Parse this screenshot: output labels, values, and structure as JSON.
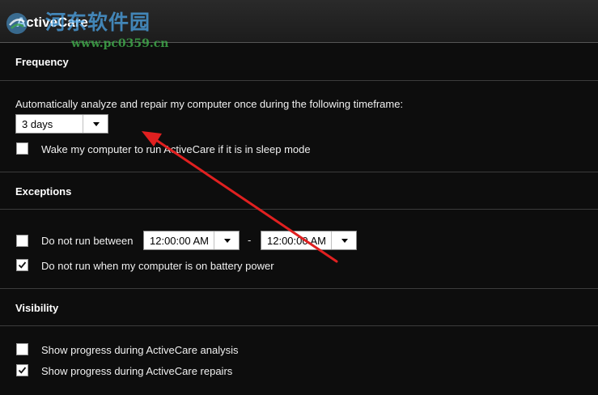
{
  "window": {
    "title": "ActiveCare"
  },
  "watermark": {
    "main": "河东软件园",
    "url": "www.pc0359.cn"
  },
  "frequency": {
    "heading": "Frequency",
    "description": "Automatically analyze and repair my computer once during the following timeframe:",
    "timeframe_value": "3 days",
    "wake_label": "Wake my computer to run ActiveCare if it is in sleep mode",
    "wake_checked": false
  },
  "exceptions": {
    "heading": "Exceptions",
    "between_label": "Do not run between",
    "between_checked": false,
    "start_time": "12:00:00 AM",
    "separator": "-",
    "end_time": "12:00:00 AM",
    "battery_label": "Do not run when my computer is on battery power",
    "battery_checked": true
  },
  "visibility": {
    "heading": "Visibility",
    "analysis_label": "Show progress during ActiveCare analysis",
    "analysis_checked": false,
    "repairs_label": "Show progress during ActiveCare repairs",
    "repairs_checked": true
  },
  "annotation": {
    "arrow_color": "#e02020"
  }
}
